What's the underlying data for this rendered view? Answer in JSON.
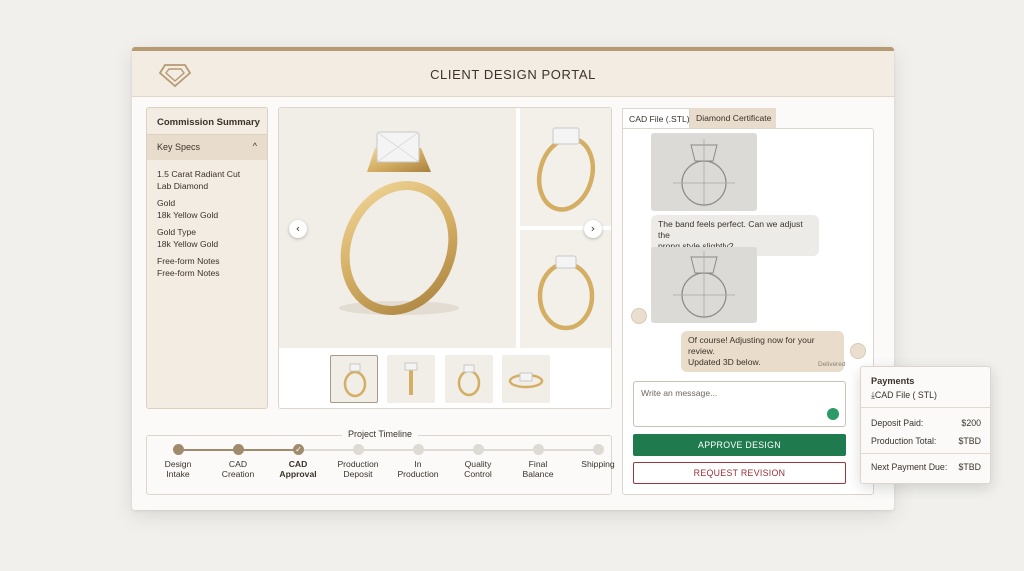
{
  "header": {
    "title": "CLIENT DESIGN PORTAL",
    "logo_icon": "diamond-logo-icon"
  },
  "sidebar": {
    "title": "Commission Summary",
    "section_label": "Key Specs",
    "specs": [
      {
        "line1": "1.5 Carat Radiant Cut",
        "line2": "Lab Diamond"
      },
      {
        "line1": "Gold",
        "line2": "18k Yellow Gold"
      },
      {
        "line1": "Gold Type",
        "line2": "18k Yellow Gold"
      },
      {
        "line1": "Free-form Notes",
        "line2": "Free-form Notes"
      }
    ]
  },
  "gallery": {
    "prev_arrow": "‹",
    "next_arrow": "›",
    "selected_thumb": 0,
    "thumb_count": 4
  },
  "timeline": {
    "title": "Project Timeline",
    "current_step": 2,
    "steps": [
      {
        "line1": "Design",
        "line2": "Intake"
      },
      {
        "line1": "CAD",
        "line2": "Creation"
      },
      {
        "line1": "CAD",
        "line2": "Approval"
      },
      {
        "line1": "Production",
        "line2": "Deposit"
      },
      {
        "line1": "In",
        "line2": "Production"
      },
      {
        "line1": "Quality",
        "line2": "Control"
      },
      {
        "line1": "Final",
        "line2": "Balance"
      },
      {
        "line1": "Shipping",
        "line2": ""
      }
    ]
  },
  "tabs": [
    {
      "label": "CAD File (.STL)",
      "active": true
    },
    {
      "label": "Diamond Certificate",
      "active": false
    }
  ],
  "chat": {
    "messages": [
      {
        "from": "client",
        "lines": [
          "The band feels perfect. Can we adjust the",
          "prong style slightly?"
        ]
      },
      {
        "from": "designer",
        "lines": [
          "Of course! Adjusting now for your review.",
          "Updated 3D below."
        ]
      }
    ],
    "status": "Delivered",
    "input_placeholder": "Write an message..."
  },
  "actions": {
    "approve": "APPROVE DESIGN",
    "revise": "REQUEST REVISION"
  },
  "payments": {
    "title": "Payments",
    "file": "CAD File ( STL)",
    "rows": [
      {
        "label": "Deposit Paid:",
        "value": "$200"
      },
      {
        "label": "Production Total:",
        "value": "$TBD"
      },
      {
        "label": "Next Payment Due:",
        "value": "$TBD"
      }
    ]
  },
  "colors": {
    "accent_gold": "#b59a72",
    "approve_green": "#1f7a4e",
    "revise_red": "#9a2e35",
    "header_bg": "#f3ece3"
  }
}
